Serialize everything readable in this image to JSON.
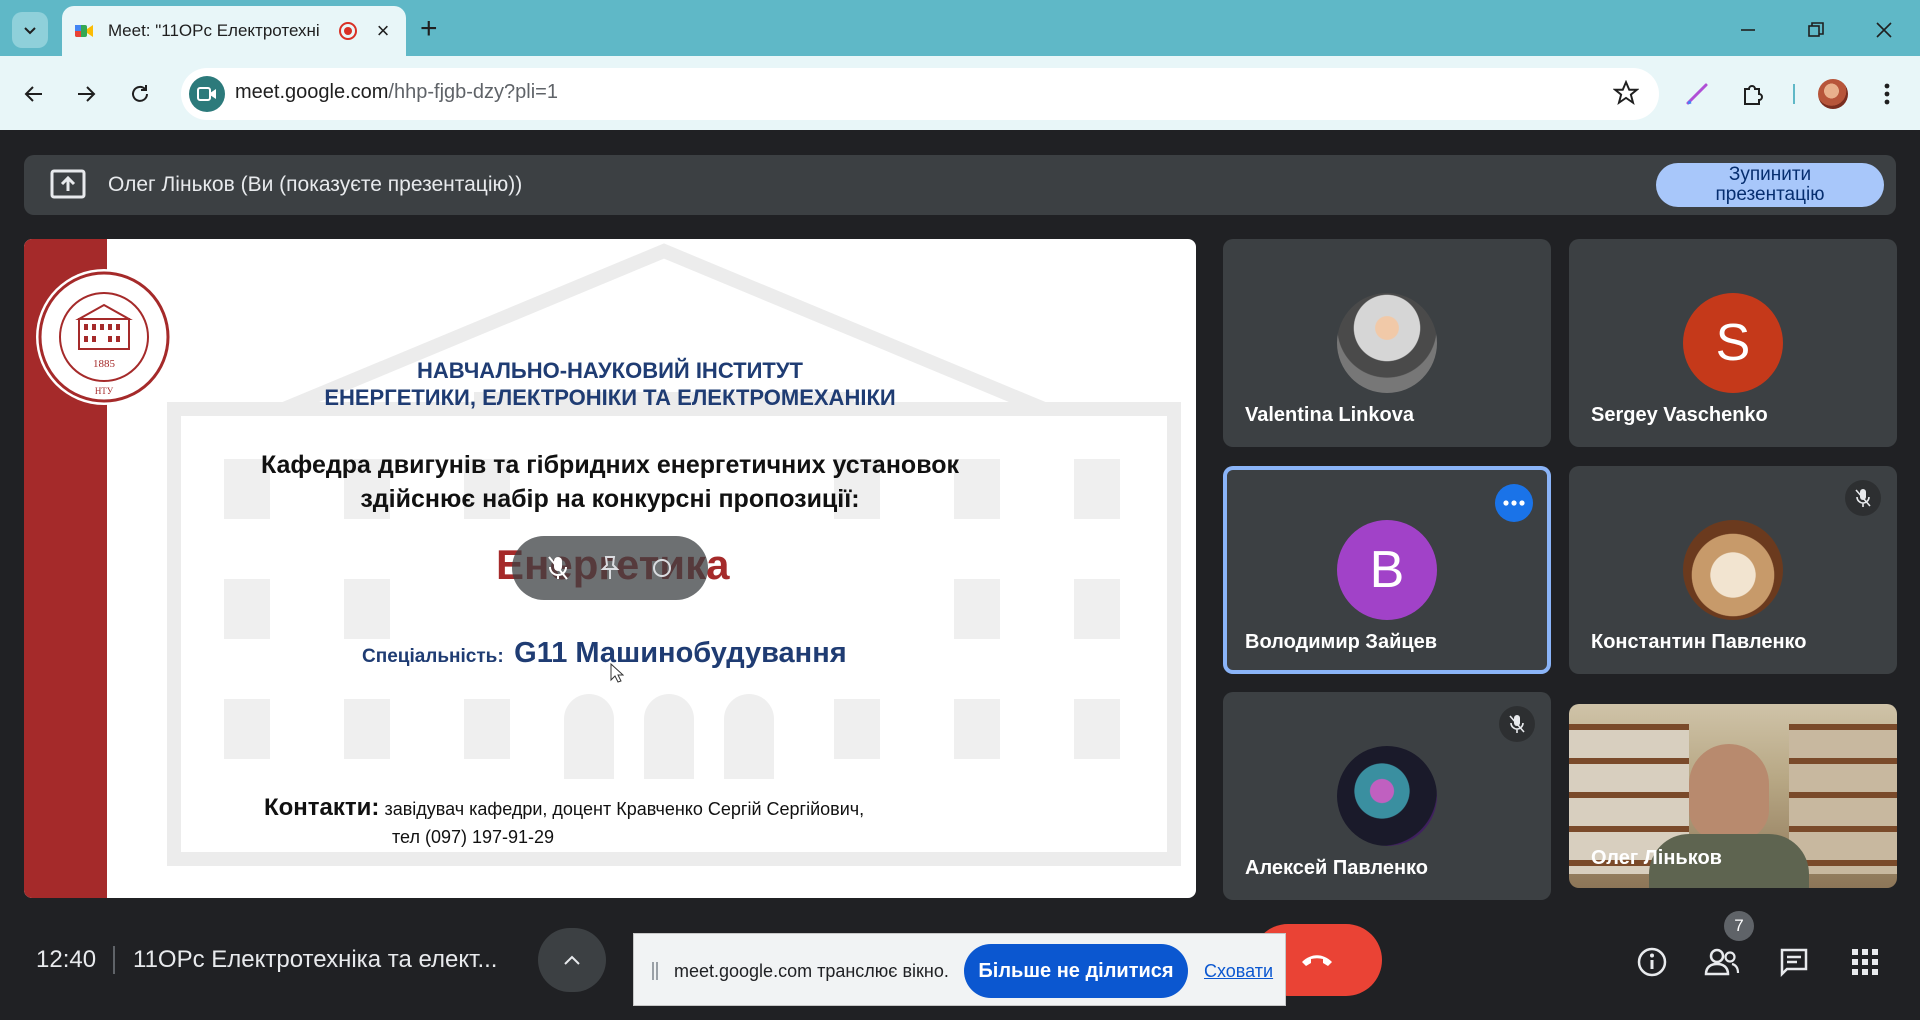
{
  "browser": {
    "tab_title": "Meet: \"11ОРс Електротехні",
    "url_host": "meet.google.com",
    "url_path": "/hhp-fjgb-dzy?pli=1"
  },
  "meet": {
    "presenting_text": "Олег Ліньков (Ви (показуєте презентацію))",
    "stop_presenting_line1": "Зупинити",
    "stop_presenting_line2": "презентацію",
    "time": "12:40",
    "meeting_name": "11ОРс Електротехніка та елект...",
    "participant_count": "7",
    "participants": [
      {
        "name": "Valentina Linkova",
        "avatar": "photo"
      },
      {
        "name": "Sergey Vaschenko",
        "avatar_letter": "S",
        "color": "#c5391a"
      },
      {
        "name": "Володимир Зайцев",
        "avatar_letter": "В",
        "color": "#a142c8"
      },
      {
        "name": "Константин Павленко",
        "avatar": "photo",
        "muted": true
      },
      {
        "name": "Алексей Павленко",
        "avatar": "photo",
        "muted": true
      },
      {
        "name": "Олег Ліньков",
        "avatar": "video"
      }
    ],
    "share_bar": {
      "message": "meet.google.com транслює вікно.",
      "stop_button": "Більше не ділитися",
      "hide_link": "Сховати"
    }
  },
  "slide": {
    "seal_year": "1885",
    "seal_abbr": "НТУ",
    "institute_line1": "НАВЧАЛЬНО-НАУКОВИЙ ІНСТИТУТ",
    "institute_line2": "ЕНЕРГЕТИКИ, ЕЛЕКТРОНІКИ ТА ЕЛЕКТРОМЕХАНІКИ",
    "dept_line1": "Кафедра двигунів та гібридних енергетичних установок",
    "dept_line2": "здійснює набір на конкурсні пропозиції:",
    "program": "Енергетика",
    "specialty_label": "Спеціальність:",
    "specialty_value": "G11 Машинобудування",
    "contacts_label": "Контакти:",
    "contacts_line1": "завідувач кафедри, доцент Кравченко Сергій Сергійович,",
    "contacts_line2": "тел (097) 197-91-29"
  },
  "colors": {
    "accent": "#a8c7fa",
    "end_call": "#ea4335",
    "slide_band": "#a52a2a",
    "slide_blue": "#1f3c73"
  }
}
